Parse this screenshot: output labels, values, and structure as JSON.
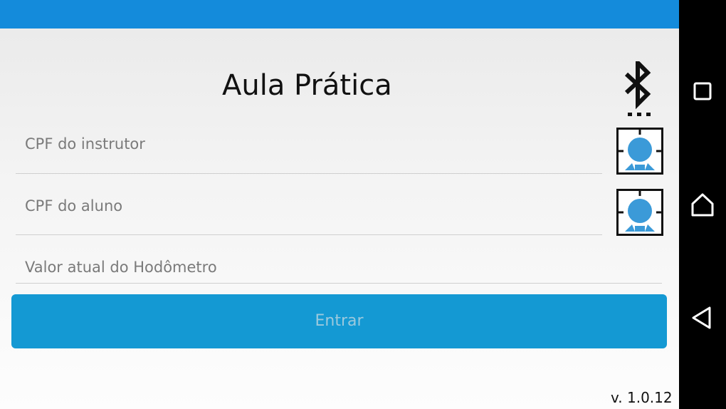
{
  "app": {
    "title": "Aula Prática",
    "version": "v. 1.0.12",
    "colors": {
      "top_bar": "#148bdb",
      "button": "#1499d3",
      "button_text": "#9cc9dd",
      "biometric_accent": "#3b9ad8"
    }
  },
  "header": {
    "bluetooth_icon": "bluetooth-searching-icon"
  },
  "form": {
    "instructor_cpf": {
      "placeholder": "CPF do instrutor",
      "value": ""
    },
    "student_cpf": {
      "placeholder": "CPF do aluno",
      "value": ""
    },
    "odometer": {
      "placeholder": "Valor atual do Hodômetro",
      "value": ""
    },
    "instructor_biometric_icon": "fingerprint-face-scan-icon",
    "student_biometric_icon": "fingerprint-face-scan-icon",
    "submit_label": "Entrar"
  },
  "system_nav": {
    "recents_icon": "square-recents-icon",
    "home_icon": "home-icon",
    "back_icon": "back-triangle-icon"
  }
}
